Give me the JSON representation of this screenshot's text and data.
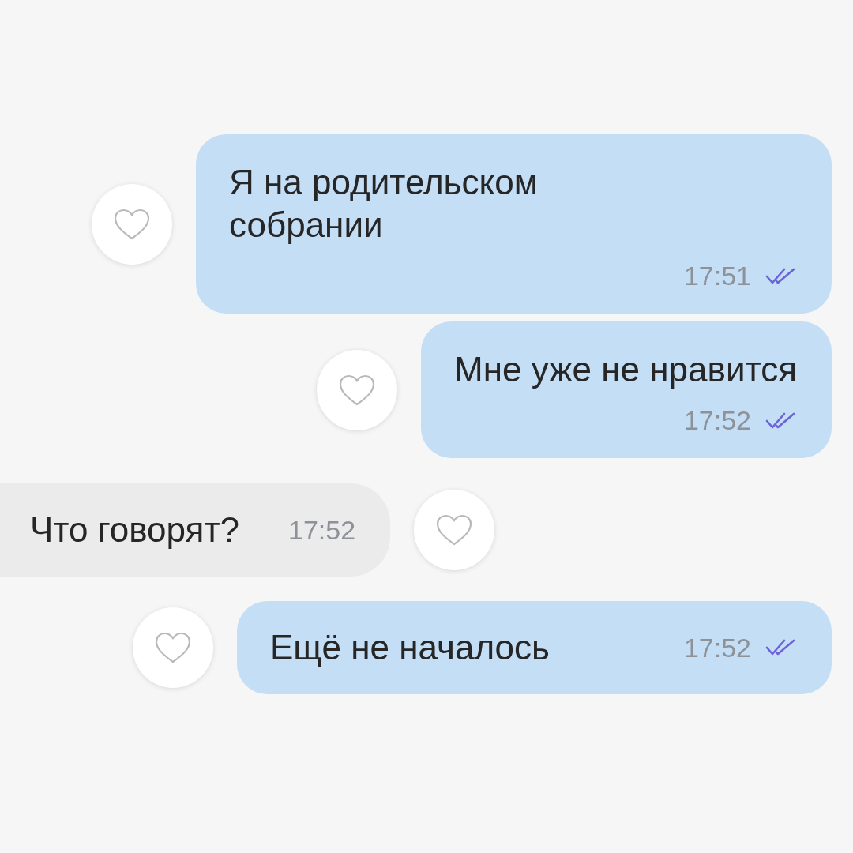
{
  "messages": [
    {
      "kind": "outgoing",
      "text": "Я на родительском собрании",
      "time": "17:51",
      "time_below": true,
      "read": true,
      "liked": false
    },
    {
      "kind": "outgoing",
      "text": "Мне уже не нравится",
      "time": "17:52",
      "time_below": true,
      "read": true,
      "liked": false
    },
    {
      "kind": "incoming",
      "text": "Что говорят?",
      "time": "17:52",
      "time_below": false,
      "liked": false
    },
    {
      "kind": "outgoing",
      "text": "Ещё не началось",
      "time": "17:52",
      "time_below": false,
      "read": true,
      "liked": false
    }
  ]
}
